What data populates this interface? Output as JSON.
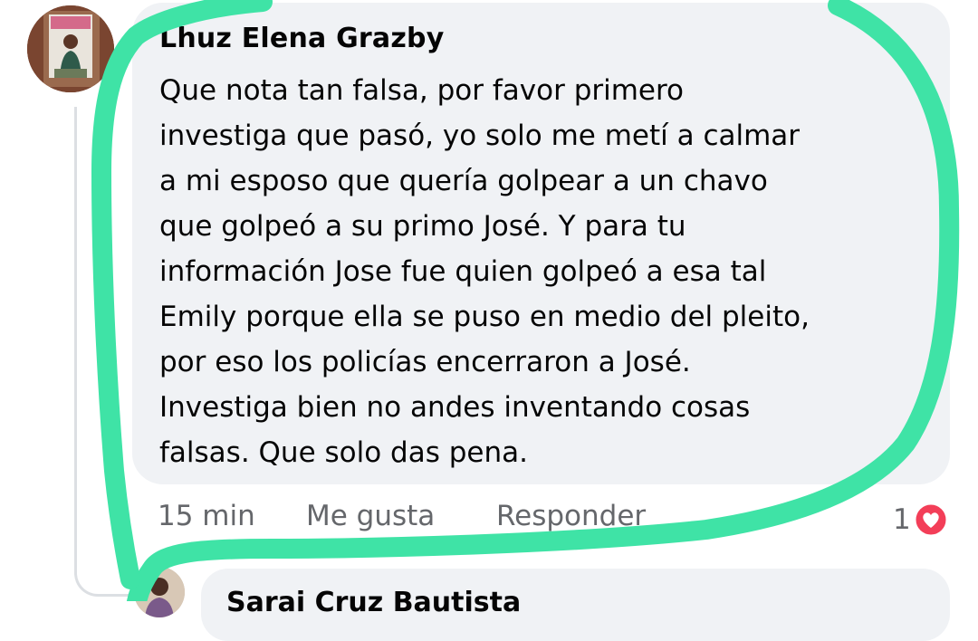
{
  "comment": {
    "author": "Lhuz Elena Grazby",
    "text_lines": [
      "Que nota tan falsa, por favor primero",
      "investiga que pasó, yo solo me metí a calmar",
      "a mi esposo que quería golpear a un chavo",
      "que golpeó a su primo José. Y para tu",
      "información Jose fue quien golpeó a esa tal",
      "Emily porque ella se puso en medio del pleito,",
      "por eso los policías encerraron a José.",
      "Investiga bien no andes inventando cosas",
      "falsas. Que solo das pena."
    ],
    "time": "15 min",
    "like_label": "Me gusta",
    "reply_label": "Responder",
    "reaction_count": "1",
    "reaction_icon": "love-reaction-icon"
  },
  "next_comment": {
    "author": "Sarai Cruz Bautista"
  },
  "colors": {
    "bubble": "#f0f2f5",
    "meta_text": "#65676b",
    "highlight": "#3fe3a6",
    "love": "#f33e58"
  }
}
